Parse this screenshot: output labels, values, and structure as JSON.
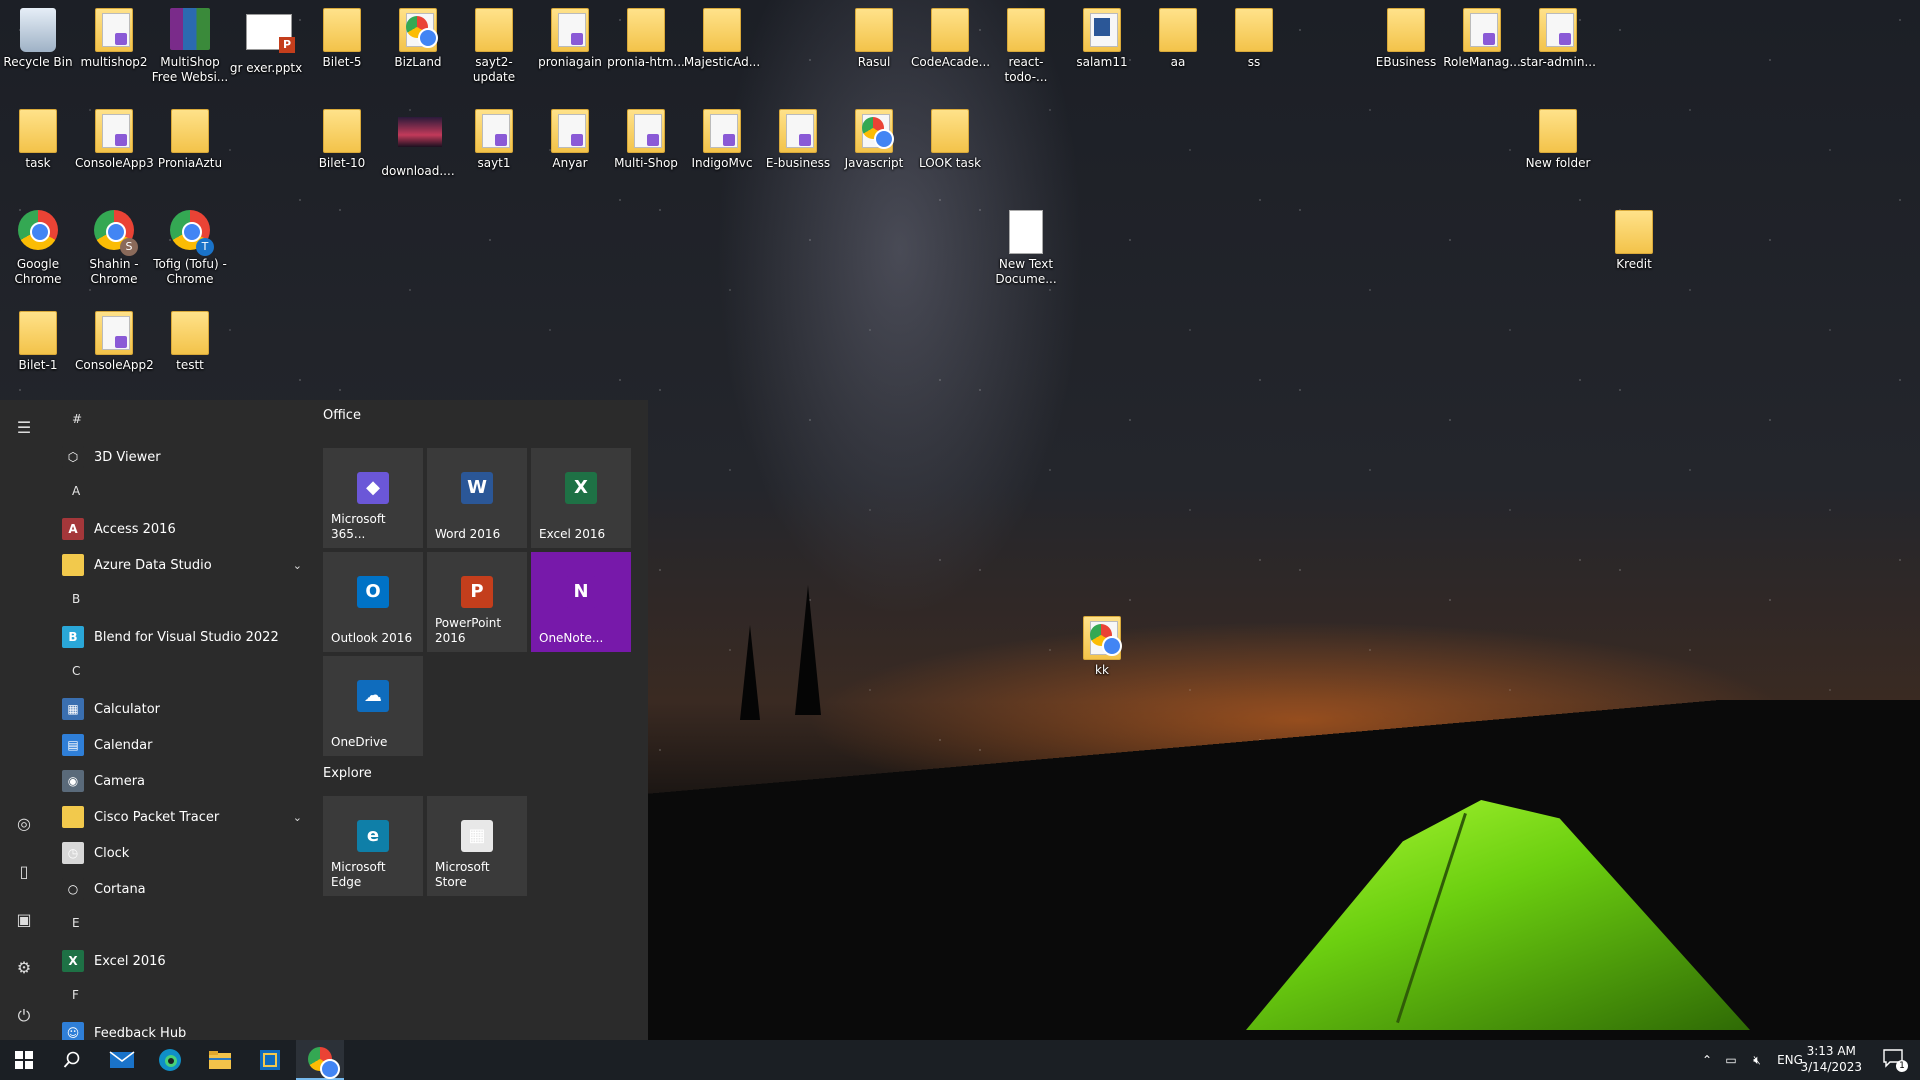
{
  "desktop": {
    "icons_row1": [
      {
        "label": "Recycle Bin",
        "icon": "recycle-bin-icon"
      },
      {
        "label": "multishop2",
        "icon": "folder-vs-icon"
      },
      {
        "label": "MultiShop Free Websi...",
        "icon": "winrar-archive-icon"
      },
      {
        "label": "gr exer.pptx",
        "icon": "powerpoint-file-icon"
      },
      {
        "label": "Bilet-5",
        "icon": "folder-icon"
      },
      {
        "label": "BizLand",
        "icon": "folder-chrome-icon"
      },
      {
        "label": "sayt2-update",
        "icon": "folder-icon"
      },
      {
        "label": "proniagain",
        "icon": "folder-vs-icon"
      },
      {
        "label": "pronia-htm...",
        "icon": "folder-icon"
      },
      {
        "label": "MajesticAd...",
        "icon": "folder-icon"
      },
      {
        "label": "Rasul",
        "icon": "folder-icon"
      },
      {
        "label": "CodeAcade...",
        "icon": "folder-icon"
      },
      {
        "label": "react-todo-...",
        "icon": "folder-icon"
      },
      {
        "label": "salam11",
        "icon": "folder-word-icon"
      },
      {
        "label": "aa",
        "icon": "folder-icon"
      },
      {
        "label": "ss",
        "icon": "folder-icon"
      },
      {
        "label": "EBusiness",
        "icon": "folder-icon"
      },
      {
        "label": "RoleManag...",
        "icon": "folder-vs-icon"
      },
      {
        "label": "star-admin...",
        "icon": "folder-vs-icon"
      }
    ],
    "icons_row2": [
      {
        "label": "task",
        "icon": "folder-icon"
      },
      {
        "label": "ConsoleApp3",
        "icon": "folder-vs-icon"
      },
      {
        "label": "ProniaAztu",
        "icon": "folder-icon"
      },
      {
        "label": "Bilet-10",
        "icon": "folder-icon"
      },
      {
        "label": "download....",
        "icon": "image-file-icon"
      },
      {
        "label": "sayt1",
        "icon": "folder-vs-icon"
      },
      {
        "label": "Anyar",
        "icon": "folder-vs-icon"
      },
      {
        "label": "Multi-Shop",
        "icon": "folder-vs-icon"
      },
      {
        "label": "IndigoMvc",
        "icon": "folder-vs-icon"
      },
      {
        "label": "E-business",
        "icon": "folder-vs-icon"
      },
      {
        "label": "Javascript",
        "icon": "folder-chrome-icon"
      },
      {
        "label": "LOOK task",
        "icon": "folder-icon"
      },
      {
        "label": "New folder",
        "icon": "folder-icon"
      }
    ],
    "icons_row3": [
      {
        "label": "Google Chrome",
        "icon": "chrome-icon",
        "badge": ""
      },
      {
        "label": "Shahin - Chrome",
        "icon": "chrome-icon",
        "badge": "S"
      },
      {
        "label": "Tofig (Tofu) - Chrome",
        "icon": "chrome-icon",
        "badge": "T"
      },
      {
        "label": "New Text Docume...",
        "icon": "text-file-icon"
      },
      {
        "label": "Kredit",
        "icon": "folder-icon"
      }
    ],
    "icons_row4": [
      {
        "label": "Bilet-1",
        "icon": "folder-icon"
      },
      {
        "label": "ConsoleApp2",
        "icon": "folder-vs-icon"
      },
      {
        "label": "testt",
        "icon": "folder-icon"
      }
    ],
    "floating_icon": {
      "label": "kk",
      "icon": "folder-chrome-icon"
    }
  },
  "start_menu": {
    "app_list": [
      {
        "type": "header",
        "label": "#"
      },
      {
        "type": "app",
        "label": "3D Viewer",
        "icon": "cube-icon",
        "color": "#2b2b2b",
        "glyph": "⬡"
      },
      {
        "type": "header",
        "label": "A"
      },
      {
        "type": "app",
        "label": "Access 2016",
        "icon": "access-icon",
        "color": "#a4373a",
        "glyph": "A"
      },
      {
        "type": "app",
        "label": "Azure Data Studio",
        "icon": "folder-icon",
        "color": "#f2c94c",
        "glyph": "",
        "expand": true
      },
      {
        "type": "header",
        "label": "B"
      },
      {
        "type": "app",
        "label": "Blend for Visual Studio 2022",
        "icon": "blend-icon",
        "color": "#2aa7d8",
        "glyph": "B"
      },
      {
        "type": "header",
        "label": "C"
      },
      {
        "type": "app",
        "label": "Calculator",
        "icon": "calculator-icon",
        "color": "#3a6fb0",
        "glyph": "▦"
      },
      {
        "type": "app",
        "label": "Calendar",
        "icon": "calendar-icon",
        "color": "#2f7fd8",
        "glyph": "▤"
      },
      {
        "type": "app",
        "label": "Camera",
        "icon": "camera-icon",
        "color": "#5a6a7a",
        "glyph": "◉"
      },
      {
        "type": "app",
        "label": "Cisco Packet Tracer",
        "icon": "folder-icon",
        "color": "#f2c94c",
        "glyph": "",
        "expand": true
      },
      {
        "type": "app",
        "label": "Clock",
        "icon": "clock-icon",
        "color": "#d8d8d8",
        "glyph": "◷"
      },
      {
        "type": "app",
        "label": "Cortana",
        "icon": "cortana-icon",
        "color": "#2b2b2b",
        "glyph": "○"
      },
      {
        "type": "header",
        "label": "E"
      },
      {
        "type": "app",
        "label": "Excel 2016",
        "icon": "excel-icon",
        "color": "#1e7145",
        "glyph": "X"
      },
      {
        "type": "header",
        "label": "F"
      },
      {
        "type": "app",
        "label": "Feedback Hub",
        "icon": "feedback-icon",
        "color": "#2f7fd8",
        "glyph": "☺"
      }
    ],
    "groups": [
      {
        "label": "Office"
      },
      {
        "label": "Explore"
      }
    ],
    "tiles": [
      {
        "label": "Microsoft 365...",
        "icon": "microsoft-365-icon",
        "bg": "#3a3a3a",
        "color": "#6b57d8",
        "glyph": "◆"
      },
      {
        "label": "Word 2016",
        "icon": "word-icon",
        "bg": "#3a3a3a",
        "color": "#2b5797",
        "glyph": "W"
      },
      {
        "label": "Excel 2016",
        "icon": "excel-icon",
        "bg": "#3a3a3a",
        "color": "#1e7145",
        "glyph": "X"
      },
      {
        "label": "Outlook 2016",
        "icon": "outlook-icon",
        "bg": "#3a3a3a",
        "color": "#0072c6",
        "glyph": "O"
      },
      {
        "label": "PowerPoint 2016",
        "icon": "powerpoint-icon",
        "bg": "#3a3a3a",
        "color": "#c43e1c",
        "glyph": "P"
      },
      {
        "label": "OneNote...",
        "icon": "onenote-icon",
        "bg": "#7719aa",
        "color": "#7719aa",
        "glyph": "N"
      },
      {
        "label": "OneDrive",
        "icon": "onedrive-icon",
        "bg": "#3a3a3a",
        "color": "#0f6cbd",
        "glyph": "☁"
      },
      {
        "label": "Microsoft Edge",
        "icon": "edge-icon",
        "bg": "#3a3a3a",
        "color": "#0f7fa8",
        "glyph": "e"
      },
      {
        "label": "Microsoft Store",
        "icon": "store-icon",
        "bg": "#3a3a3a",
        "color": "#e8e8e8",
        "glyph": "▦"
      }
    ]
  },
  "taskbar": {
    "items": [
      "start-button",
      "search-button",
      "mail-icon",
      "edge-icon",
      "file-explorer-icon",
      "remote-desktop-icon",
      "chrome-icon"
    ],
    "language": "ENG",
    "time": "3:13 AM",
    "date": "3/14/2023",
    "notification_count": "1"
  }
}
